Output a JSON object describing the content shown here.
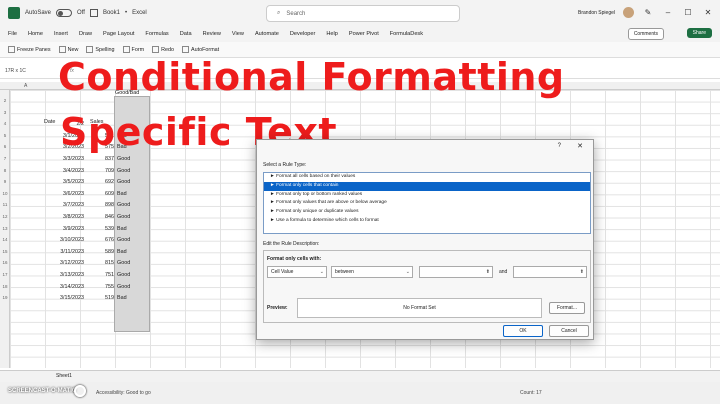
{
  "titlebar": {
    "autosave": "AutoSave",
    "toggle": "Off",
    "file": "Book1",
    "app": "Excel",
    "search": "Search",
    "user": "Brandon Spiegel"
  },
  "menu": [
    "File",
    "Home",
    "Insert",
    "Draw",
    "Page Layout",
    "Formulas",
    "Data",
    "Review",
    "View",
    "Automate",
    "Developer",
    "Help",
    "Power Pivot",
    "FormulaDesk"
  ],
  "menu_right": {
    "comments": "Comments",
    "share": "Share"
  },
  "quick": [
    "Freeze Panes",
    "New",
    "Spelling",
    "Form",
    "Redo",
    "AutoFormat"
  ],
  "namebox": "17R x 1C",
  "fx": "fx",
  "columns": [
    "A"
  ],
  "headers": {
    "date": "Date",
    "sales": "Sales",
    "gb": "Good/Bad"
  },
  "rows": [
    {
      "n": "2",
      "date": "",
      "sales": "",
      "gb": ""
    },
    {
      "n": "3",
      "date": "2/2",
      "sales": "",
      "gb": ""
    },
    {
      "n": "4",
      "date": "2/2",
      "sales": "",
      "gb": ""
    },
    {
      "n": "5",
      "date": "3/1/2023",
      "sales": "541",
      "gb": "Bad"
    },
    {
      "n": "6",
      "date": "3/2/2023",
      "sales": "575",
      "gb": "Bad"
    },
    {
      "n": "7",
      "date": "3/3/2023",
      "sales": "837",
      "gb": "Good"
    },
    {
      "n": "8",
      "date": "3/4/2023",
      "sales": "709",
      "gb": "Good"
    },
    {
      "n": "9",
      "date": "3/5/2023",
      "sales": "692",
      "gb": "Good"
    },
    {
      "n": "10",
      "date": "3/6/2023",
      "sales": "609",
      "gb": "Bad"
    },
    {
      "n": "11",
      "date": "3/7/2023",
      "sales": "898",
      "gb": "Good"
    },
    {
      "n": "12",
      "date": "3/8/2023",
      "sales": "846",
      "gb": "Good"
    },
    {
      "n": "13",
      "date": "3/9/2023",
      "sales": "539",
      "gb": "Bad"
    },
    {
      "n": "14",
      "date": "3/10/2023",
      "sales": "676",
      "gb": "Good"
    },
    {
      "n": "15",
      "date": "3/11/2023",
      "sales": "589",
      "gb": "Bad"
    },
    {
      "n": "16",
      "date": "3/12/2023",
      "sales": "815",
      "gb": "Good"
    },
    {
      "n": "17",
      "date": "3/13/2023",
      "sales": "751",
      "gb": "Good"
    },
    {
      "n": "18",
      "date": "3/14/2023",
      "sales": "755",
      "gb": "Good"
    },
    {
      "n": "19",
      "date": "3/15/2023",
      "sales": "519",
      "gb": "Bad"
    }
  ],
  "overlay": {
    "line1": "Conditional Formatting",
    "line2": "Specific Text"
  },
  "dialog": {
    "help": "?",
    "close": "✕",
    "select_rule_type": "Select a Rule Type:",
    "rules": [
      "► Format all cells based on their values",
      "► Format only cells that contain",
      "► Format only top or bottom ranked values",
      "► Format only values that are above or below average",
      "► Format only unique or duplicate values",
      "► Use a formula to determine which cells to format"
    ],
    "edit_desc": "Edit the Rule Description:",
    "format_only_with": "Format only cells with:",
    "cell_value": "Cell Value",
    "between": "between",
    "and": "and",
    "preview": "Preview:",
    "no_format": "No Format Set",
    "format_btn": "Format...",
    "ok": "OK",
    "cancel": "Cancel"
  },
  "sheet": {
    "tab": "Sheet1"
  },
  "status": {
    "access": "Accessibility: Good to go",
    "count": "Count: 17",
    "watermark": "SCREENCAST-O-MATIC"
  }
}
